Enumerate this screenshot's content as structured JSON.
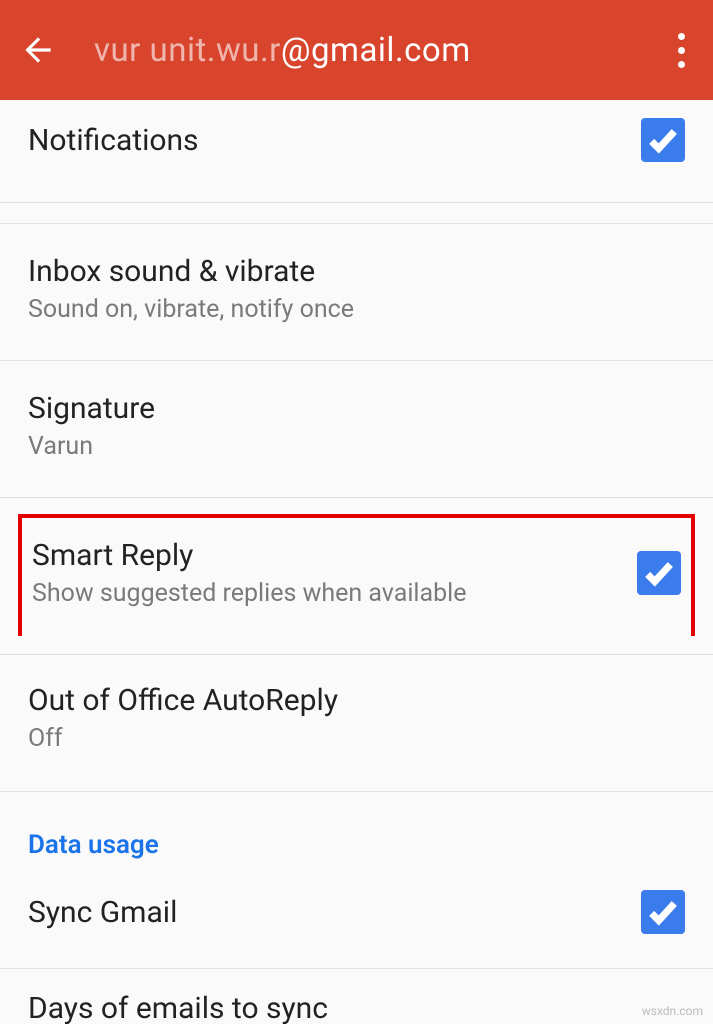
{
  "header": {
    "title_partial": " ‎ ‎ ·‎ ‎ ‎ ‎ ‎ ‎ ‎ ‎ ‎ ‎ ‎· ‎ · ‎ ‎ ‎ ;@gmail.com",
    "title": "@gmail.com"
  },
  "rows": {
    "notifications": {
      "title": "Notifications",
      "checked": true
    },
    "inbox_sound": {
      "title": "Inbox sound & vibrate",
      "subtitle": "Sound on, vibrate, notify once"
    },
    "signature": {
      "title": "Signature",
      "subtitle": "Varun"
    },
    "smart_reply": {
      "title": "Smart Reply",
      "subtitle": "Show suggested replies when available",
      "checked": true
    },
    "out_of_office": {
      "title": "Out of Office AutoReply",
      "subtitle": "Off"
    },
    "sync_gmail": {
      "title": "Sync Gmail",
      "checked": true
    },
    "days_to_sync": {
      "title": "Days of emails to sync"
    }
  },
  "sections": {
    "data_usage": "Data usage"
  },
  "watermark": "wsxdn.com"
}
